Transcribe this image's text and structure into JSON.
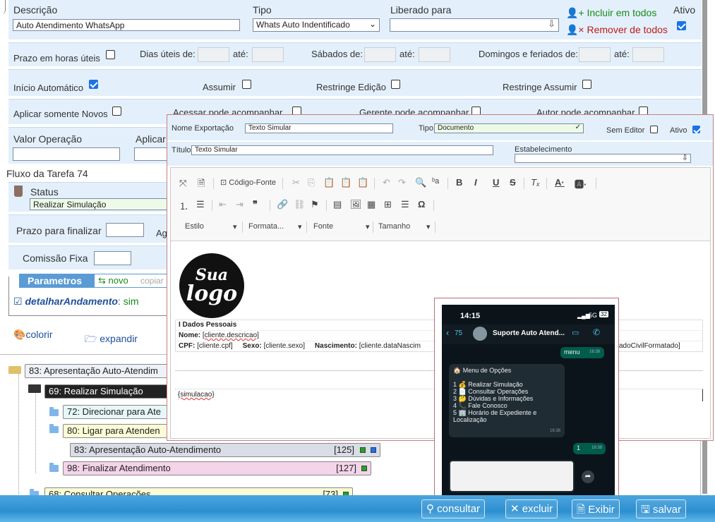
{
  "form": {
    "descricao_label": "Descrição",
    "descricao_value": "Auto Atendimento WhatsApp",
    "tipo_label": "Tipo",
    "tipo_value": "Whats Auto Indentificado",
    "liberado_label": "Liberado para",
    "incluir_todos": "Incluir em todos",
    "remover_todos": "Remover de todos",
    "ativo_label": "Ativo",
    "prazo_horas_uteis": "Prazo em horas úteis",
    "dias_uteis_de": "Dias úteis de:",
    "ate": "até:",
    "sabados_de": "Sábados de:",
    "domingos_feriados_de": "Domingos e feriados de:",
    "inicio_automatico": "Início Automático",
    "assumir": "Assumir",
    "restringe_edicao": "Restringe Edição",
    "restringe_assumir": "Restringe Assumir",
    "aplicar_somente_novos": "Aplicar somente Novos",
    "acessar_acompanhar": "Acessar pode acompanhar",
    "gerente_acompanhar": "Gerente pode acompanhar",
    "autor_acompanhar": "Autor pode acompanhar",
    "valor_operacao": "Valor Operação",
    "aplicar": "Aplicar"
  },
  "flow": {
    "title": "Fluxo da Tarefa 74",
    "status_label": "Status",
    "status_value": "Realizar Simulação",
    "prazo_finalizar": "Prazo para finalizar",
    "ag": "Ag",
    "comissao_fixa": "Comissão Fixa",
    "parametros": "Parametros",
    "novo": "novo",
    "copiar": "copiar",
    "param_name": "detalharAndamento",
    "param_value": "sim",
    "colorir": "colorir",
    "expandir": "expandir"
  },
  "tree": [
    {
      "label": "83: Apresentação Auto-Atendim",
      "badge": ""
    },
    {
      "label": "69: Realizar Simulação",
      "badge": ""
    },
    {
      "label": "72: Direcionar para Ate",
      "badge": ""
    },
    {
      "label": "80: Ligar para Atenden",
      "badge": ""
    },
    {
      "label": "83: Apresentação Auto-Atendimento",
      "badge": "[125]"
    },
    {
      "label": "98: Finalizar Atendimento",
      "badge": "[127]"
    },
    {
      "label": "68: Consultar Operações",
      "badge": "[73]"
    }
  ],
  "modal": {
    "nome_exportacao_label": "Nome Exportação",
    "nome_exportacao_value": "Texto Simular",
    "tipo_label": "Tipo",
    "tipo_value": "Documento",
    "sem_editor": "Sem Editor",
    "ativo": "Ativo",
    "titulo_label": "Título",
    "titulo_value": "Texto Simular",
    "estabelecimento_label": "Estabelecimento",
    "codigo_fonte": "Código-Fonte",
    "estilo": "Estilo",
    "formata": "Formata...",
    "fonte": "Fonte",
    "tamanho": "Tamanho",
    "logo_line1": "Sua",
    "logo_line2": "logo",
    "dados_pessoais": "I Dados Pessoais",
    "nome_label": "Nome:",
    "nome_value": "[cliente.descricao]",
    "cpf_label": "CPF:",
    "cpf_value": "[cliente.cpf]",
    "sexo_label": "Sexo:",
    "sexo_value": "[cliente.sexo]",
    "nascimento_label": "Nascimento:",
    "nascimento_value": "[cliente.dataNascim",
    "estado_civil_value": "adoCivilFormatado]",
    "simulacao": "{simulacao}"
  },
  "phone": {
    "time": "14:15",
    "signal": "5G",
    "battery": "32",
    "back_count": "75",
    "chat_name": "Suporte Auto Atend...",
    "sent_msg": "menu",
    "sent_time": "16:38",
    "menu_title": "Menu de Opções",
    "options": [
      "1 💰 Realizar Simulação",
      "2 📄 Consultar Operações",
      "3 🤔 Dúvidas e Informações",
      "4 📞 Fale Conosco",
      "5 🏢 Horário de Expediente e Localização"
    ],
    "menu_time": "16:38",
    "reply_msg": "1",
    "reply_time": "16:38"
  },
  "buttons": {
    "consultar": "consultar",
    "excluir": "excluir",
    "exibir": "Exibir",
    "salvar": "salvar"
  },
  "colors": {
    "panel": "#e3f0fb",
    "green_link": "#1b8a1b",
    "red_link": "#c21818",
    "footer": "#2d8fd0"
  }
}
